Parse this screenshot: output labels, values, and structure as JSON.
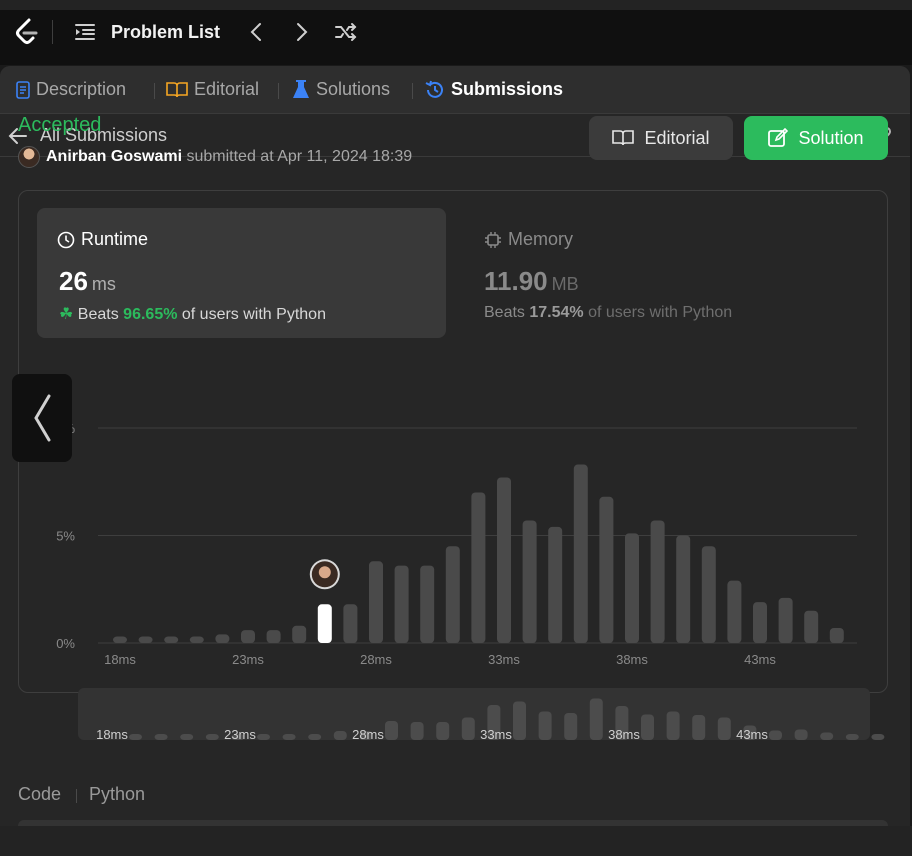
{
  "topbar": {
    "title": "Problem List"
  },
  "tabs": [
    {
      "label": "Description",
      "icon": "document-icon"
    },
    {
      "label": "Editorial",
      "icon": "book-icon"
    },
    {
      "label": "Solutions",
      "icon": "flask-icon"
    },
    {
      "label": "Submissions",
      "icon": "history-icon",
      "active": true
    }
  ],
  "back_nav": {
    "label": "All Submissions"
  },
  "submission": {
    "status": "Accepted",
    "user": "Anirban Goswami",
    "submitted_text": "submitted at Apr 11, 2024 18:39"
  },
  "buttons": {
    "editorial": "Editorial",
    "solution": "Solution"
  },
  "runtime": {
    "title": "Runtime",
    "value": "26",
    "unit": "ms",
    "beats_prefix": "Beats",
    "beats_pct": "96.65%",
    "beats_suffix": "of users with Python"
  },
  "memory": {
    "title": "Memory",
    "value": "11.90",
    "unit": "MB",
    "beats_prefix": "Beats",
    "beats_pct": "17.54%",
    "beats_suffix": "of users with Python"
  },
  "code": {
    "label": "Code",
    "language": "Python"
  },
  "colors": {
    "accent_green": "#2cbb5d",
    "bar_gray": "#4a4a4a",
    "bar_highlight": "#ffffff"
  },
  "chart_data": {
    "type": "bar",
    "x": [
      18,
      19,
      20,
      21,
      22,
      23,
      24,
      25,
      26,
      27,
      28,
      29,
      30,
      31,
      32,
      33,
      34,
      35,
      36,
      37,
      38,
      39,
      40,
      41,
      42,
      43,
      44,
      45,
      46,
      47
    ],
    "values": [
      0.3,
      0.3,
      0.3,
      0.3,
      0.4,
      0.6,
      0.6,
      0.8,
      1.8,
      1.8,
      3.8,
      3.6,
      3.6,
      4.5,
      7.0,
      7.7,
      5.7,
      5.4,
      8.3,
      6.8,
      5.1,
      5.7,
      5.0,
      4.5,
      2.9,
      1.9,
      2.1,
      1.5,
      0.7,
      0
    ],
    "highlight_x": 26,
    "ylim": [
      0,
      10
    ],
    "yticks": [
      "0%",
      "5%",
      "%"
    ],
    "xtick_labels": [
      "18ms",
      "23ms",
      "28ms",
      "33ms",
      "38ms",
      "43ms"
    ],
    "overview_xtick_labels": [
      "18ms",
      "23ms",
      "28ms",
      "33ms",
      "38ms",
      "43ms"
    ],
    "grid": true
  }
}
